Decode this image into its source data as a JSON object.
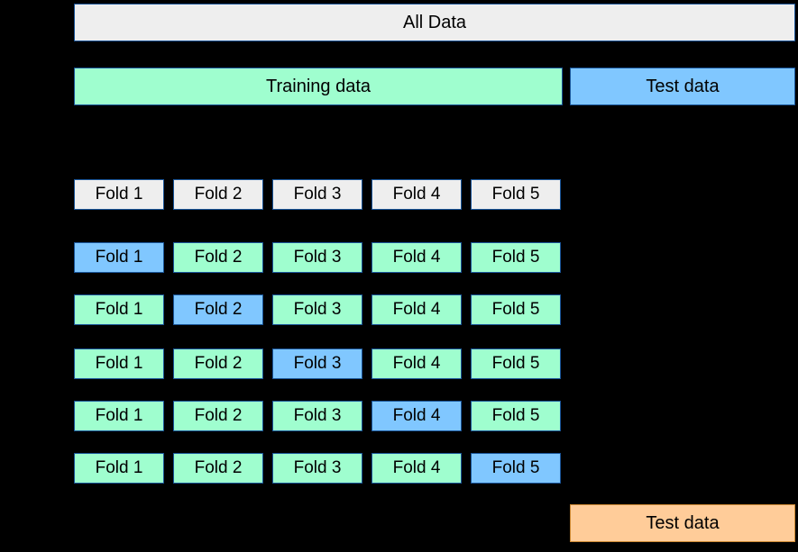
{
  "header": {
    "all_data": "All Data",
    "training_data": "Training data",
    "test_data": "Test data"
  },
  "folds": {
    "header_row": [
      "Fold 1",
      "Fold 2",
      "Fold 3",
      "Fold 4",
      "Fold 5"
    ],
    "splits": [
      {
        "validation_index": 0,
        "labels": [
          "Fold 1",
          "Fold 2",
          "Fold 3",
          "Fold 4",
          "Fold 5"
        ]
      },
      {
        "validation_index": 1,
        "labels": [
          "Fold 1",
          "Fold 2",
          "Fold 3",
          "Fold 4",
          "Fold 5"
        ]
      },
      {
        "validation_index": 2,
        "labels": [
          "Fold 1",
          "Fold 2",
          "Fold 3",
          "Fold 4",
          "Fold 5"
        ]
      },
      {
        "validation_index": 3,
        "labels": [
          "Fold 1",
          "Fold 2",
          "Fold 3",
          "Fold 4",
          "Fold 5"
        ]
      },
      {
        "validation_index": 4,
        "labels": [
          "Fold 1",
          "Fold 2",
          "Fold 3",
          "Fold 4",
          "Fold 5"
        ]
      }
    ]
  },
  "footer": {
    "test_data": "Test data"
  },
  "colors": {
    "gray": "#eeeeee",
    "green": "#9ffecf",
    "blue": "#80c7ff",
    "orange": "#ffcc99",
    "border_blue": "#1a5599",
    "border_orange": "#cc8833"
  }
}
